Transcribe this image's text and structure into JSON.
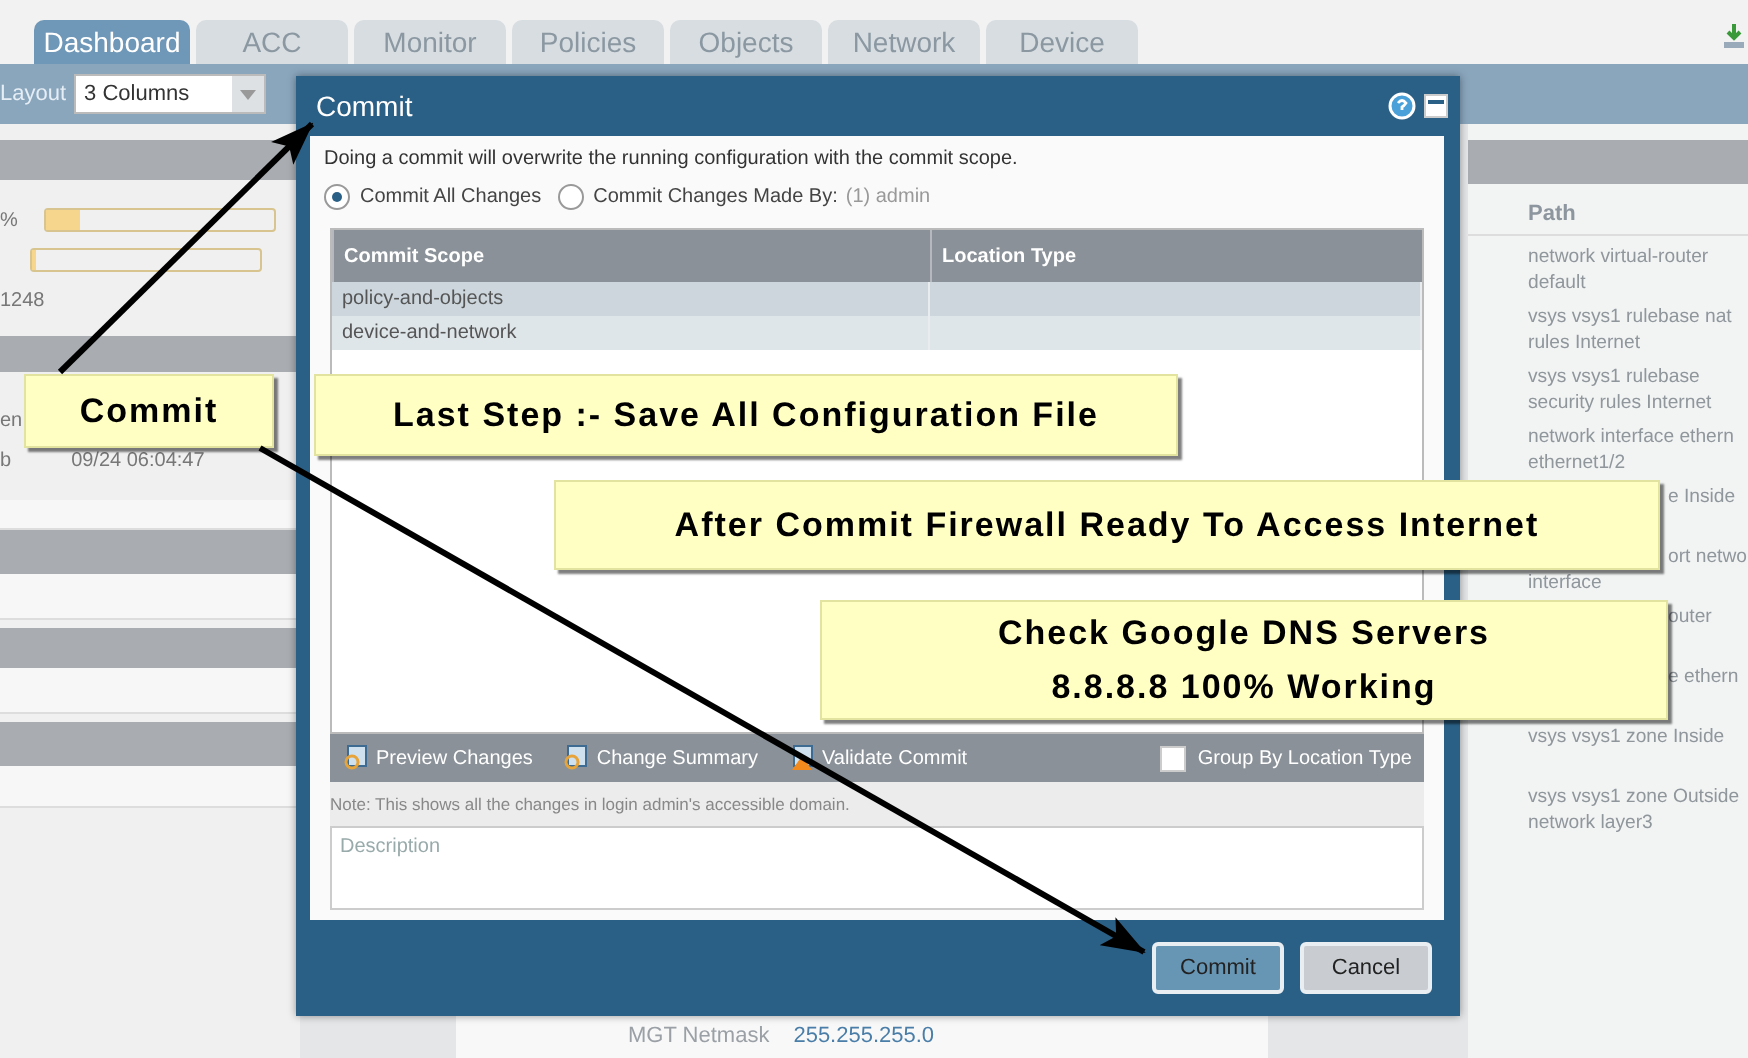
{
  "tabs": [
    {
      "label": "Dashboard",
      "selected": true
    },
    {
      "label": "ACC",
      "selected": false
    },
    {
      "label": "Monitor",
      "selected": false
    },
    {
      "label": "Policies",
      "selected": false
    },
    {
      "label": "Objects",
      "selected": false
    },
    {
      "label": "Network",
      "selected": false
    },
    {
      "label": "Device",
      "selected": false
    }
  ],
  "layout": {
    "label": "Layout",
    "value": "3 Columns"
  },
  "left_panel": {
    "meters": [
      {
        "label": "%",
        "level": 0.15
      },
      {
        "level": 0
      }
    ],
    "count": "1248",
    "column_1": "en",
    "row": {
      "column_1": "b",
      "time": "09/24 06:04:47"
    }
  },
  "right_panel": {
    "heading": "Path",
    "items": [
      {
        "kind": "full",
        "lines": [
          "network virtual-router",
          "default"
        ]
      },
      {
        "kind": "full",
        "lines": [
          "vsys vsys1 rulebase nat",
          "rules Internet"
        ]
      },
      {
        "kind": "full",
        "lines": [
          "vsys vsys1 rulebase",
          "security rules Internet"
        ]
      },
      {
        "kind": "full",
        "lines": [
          "network interface ethern",
          "ethernet1/2"
        ]
      },
      {
        "kind": "covered",
        "lines": [
          "e Inside"
        ]
      },
      {
        "kind": "covered",
        "lines": [
          "ort netwo",
          "interface"
        ]
      },
      {
        "kind": "covered",
        "lines": [
          "outer"
        ]
      },
      {
        "kind": "covered",
        "lines": [
          "e ethern"
        ]
      },
      {
        "kind": "full",
        "lines": [
          "vsys vsys1 zone Inside"
        ]
      },
      {
        "kind": "full",
        "lines": [
          "vsys vsys1 zone Outside",
          "network layer3"
        ]
      }
    ]
  },
  "dialog": {
    "title": "Commit",
    "message": "Doing a commit will overwrite the running configuration with the commit scope.",
    "scope_options": [
      {
        "label": "Commit All Changes",
        "selected": true
      },
      {
        "label": "Commit Changes Made By:",
        "selected": false
      }
    ],
    "made_by": "(1) admin",
    "table": {
      "columns": [
        "Commit Scope",
        "Location Type"
      ],
      "rows": [
        {
          "scope": "policy-and-objects"
        },
        {
          "scope": "device-and-network"
        }
      ]
    },
    "actions": [
      "Preview Changes",
      "Change Summary",
      "Validate Commit"
    ],
    "group_by": {
      "label": "Group By Location Type",
      "checked": false
    },
    "note": "Note: This shows all the changes in login admin's accessible domain.",
    "description": {
      "placeholder": "Description"
    },
    "buttons": [
      {
        "label": "Commit",
        "primary": true
      },
      {
        "label": "Cancel",
        "primary": false
      }
    ]
  },
  "bottom_field": {
    "label": "MGT Netmask",
    "value": "255.255.255.0"
  },
  "callouts": [
    {
      "lines": [
        "Commit"
      ]
    },
    {
      "lines": [
        "Last Step :- Save All Configuration File"
      ]
    },
    {
      "lines": [
        "After Commit Firewall Ready To Access Internet"
      ]
    },
    {
      "lines": [
        "Check Google DNS Servers",
        "8.8.8.8 100% Working"
      ]
    }
  ]
}
